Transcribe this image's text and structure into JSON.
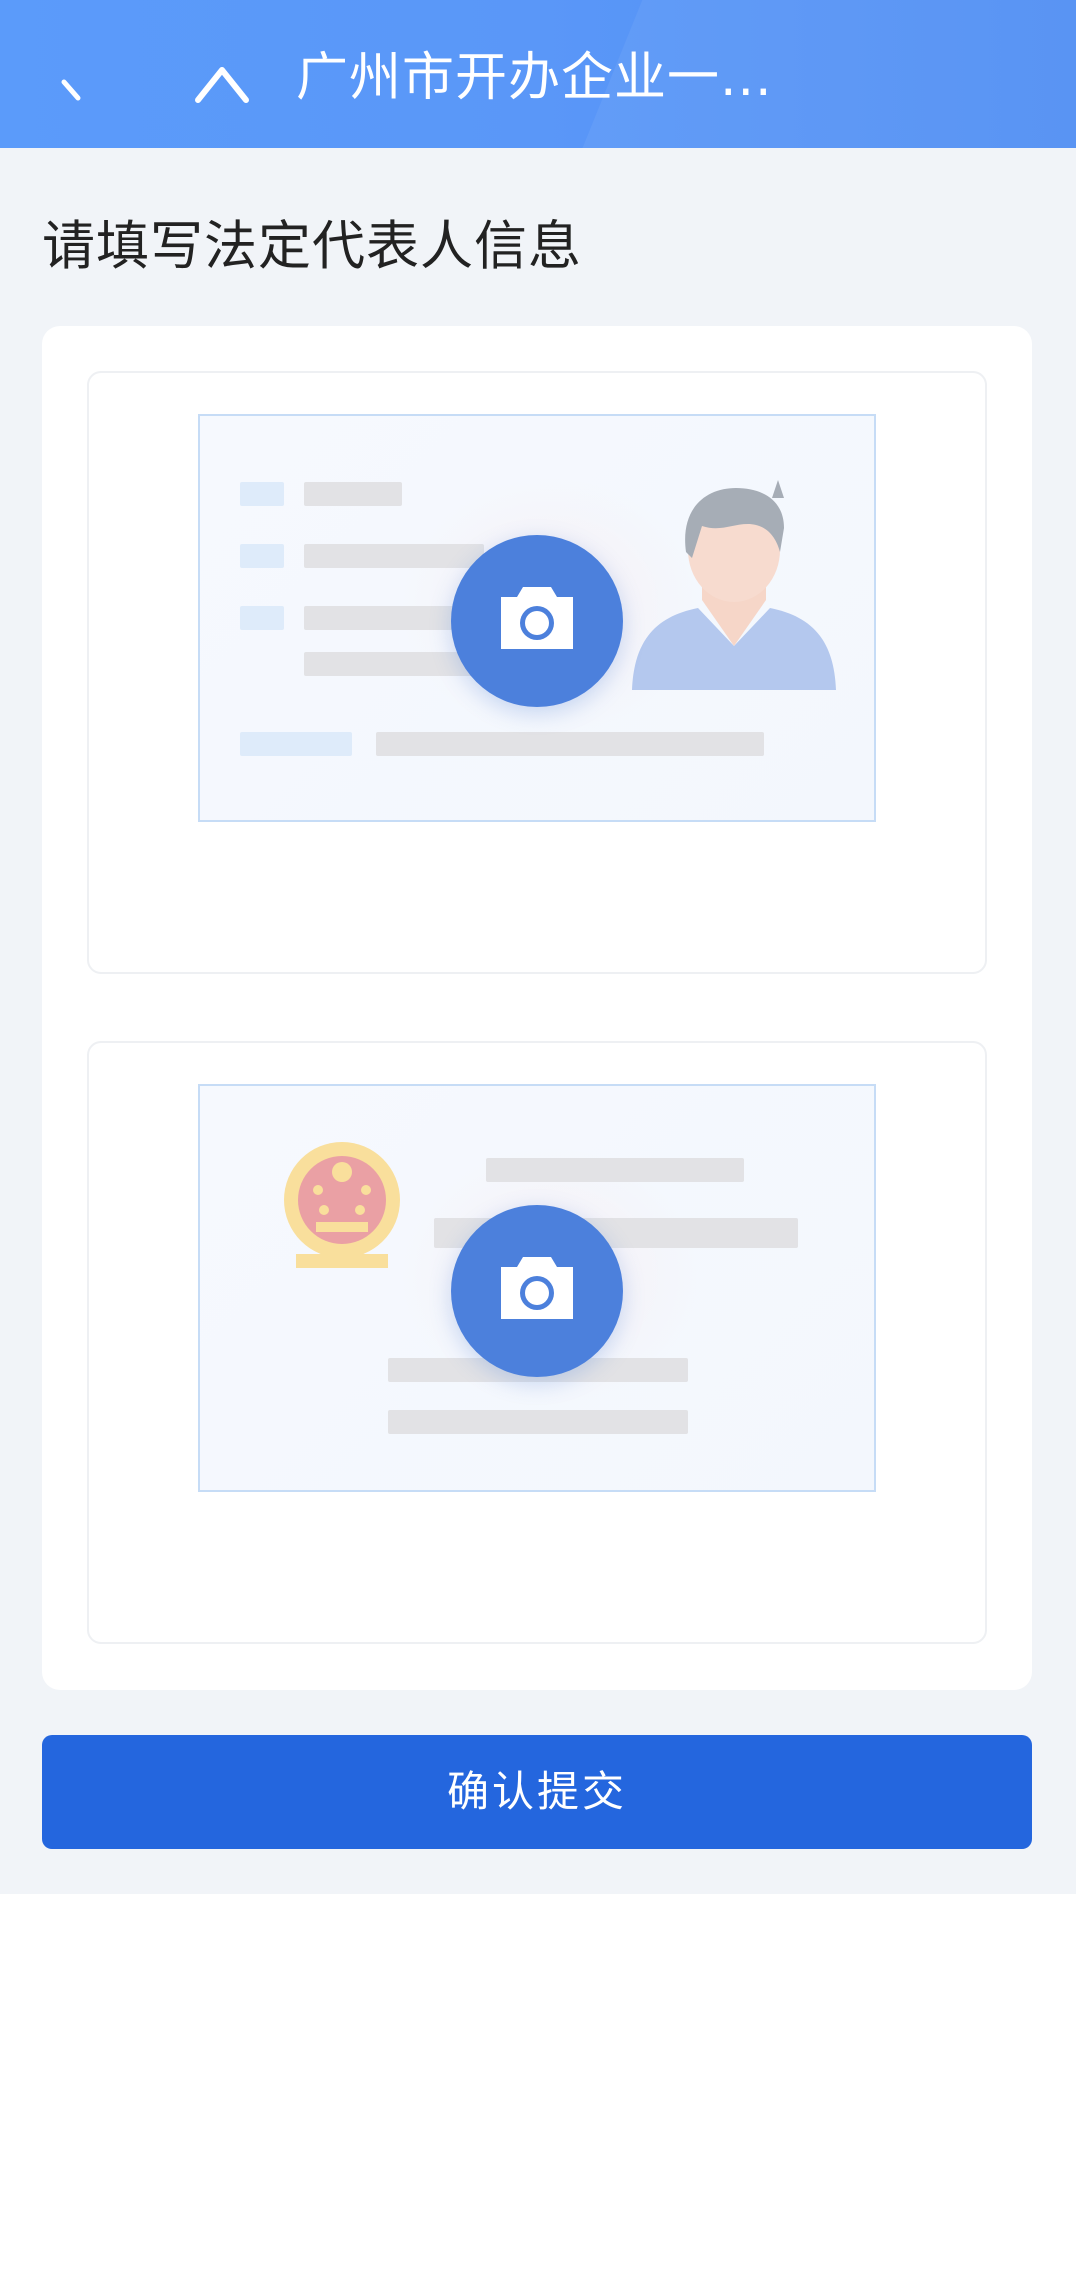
{
  "header": {
    "title": "广州市开办企业一...",
    "back_icon": "chevron-left-icon",
    "close_icon": "close-icon",
    "background_color": "#5a97f8"
  },
  "main": {
    "title": "请填写法定代表人信息",
    "uploads": [
      {
        "name": "id-card-front-upload",
        "illustration": "portrait-icon",
        "action_icon": "camera-icon"
      },
      {
        "name": "id-card-back-upload",
        "illustration": "national-emblem-icon",
        "action_icon": "camera-icon"
      }
    ],
    "submit_label": "确认提交",
    "accent_color": "#2466de"
  }
}
